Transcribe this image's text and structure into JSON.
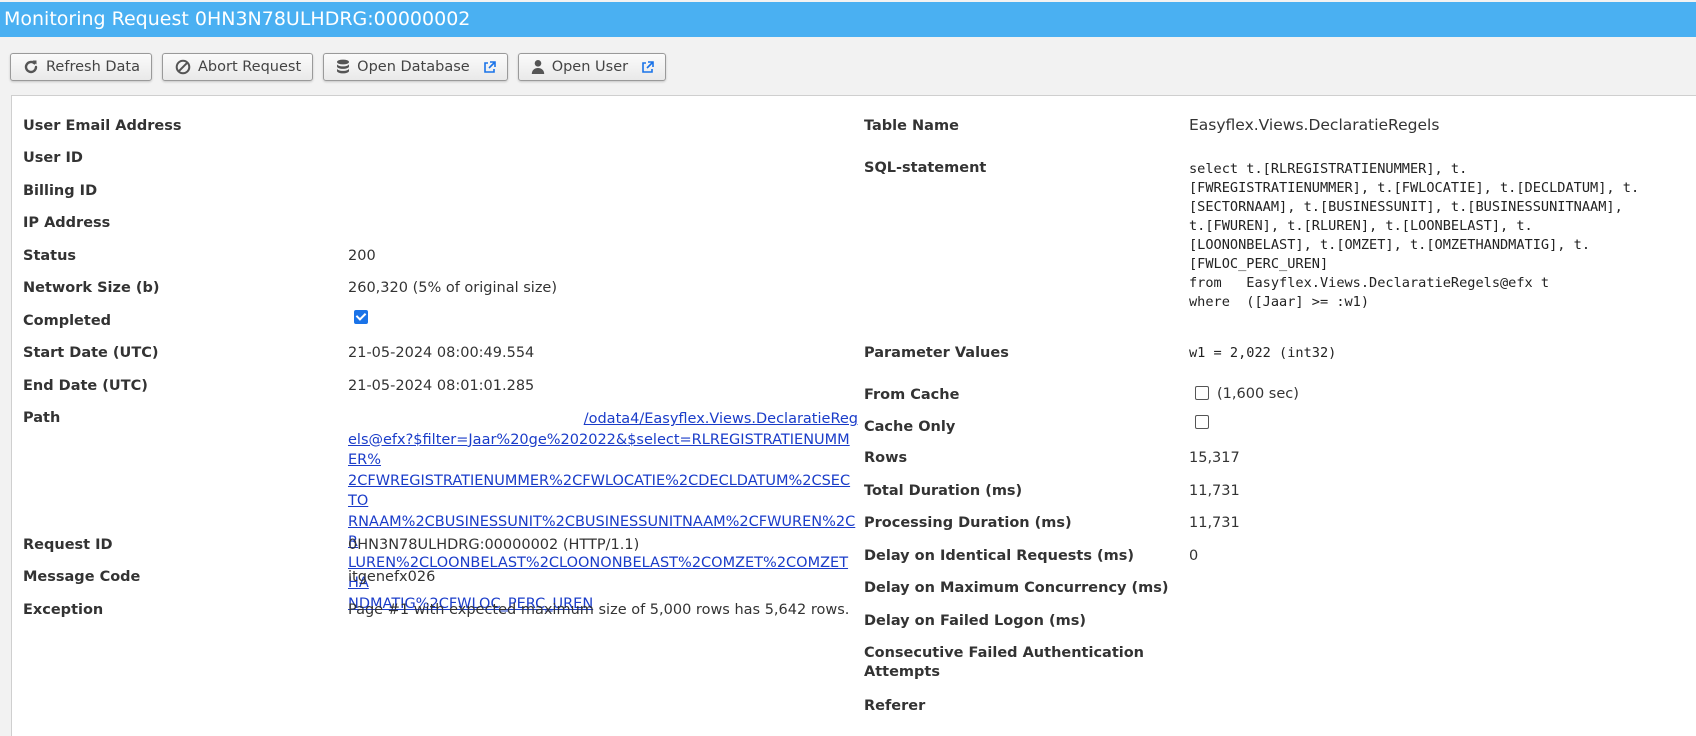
{
  "window": {
    "title": "Monitoring Request 0HN3N78ULHDRG:00000002"
  },
  "toolbar": {
    "refresh_label": "Refresh Data",
    "abort_label": "Abort Request",
    "open_database_label": "Open Database",
    "open_user_label": "Open User"
  },
  "left": {
    "user_email": {
      "label": "User Email Address",
      "value": ""
    },
    "user_id": {
      "label": "User ID",
      "value": ""
    },
    "billing_id": {
      "label": "Billing ID",
      "value": ""
    },
    "ip_address": {
      "label": "IP Address",
      "value": ""
    },
    "status": {
      "label": "Status",
      "value": "200"
    },
    "network_size": {
      "label": "Network Size (b)",
      "value": "260,320 (5% of original size)"
    },
    "completed": {
      "label": "Completed",
      "checked": true
    },
    "start_date": {
      "label": "Start Date (UTC)",
      "value": "21-05-2024 08:00:49.554"
    },
    "end_date": {
      "label": "End Date (UTC)",
      "value": "21-05-2024 08:01:01.285"
    },
    "path": {
      "label": "Path",
      "line1": "/odata4/Easyflex.Views.DeclaratieReg",
      "line2": "els@efx?$filter=Jaar%20ge%202022&$select=RLREGISTRATIENUMMER%",
      "line3": "2CFWREGISTRATIENUMMER%2CFWLOCATIE%2CDECLDATUM%2CSECTO",
      "line4": "RNAAM%2CBUSINESSUNIT%2CBUSINESSUNITNAAM%2CFWUREN%2CR",
      "line5": "LUREN%2CLOONBELAST%2CLOONONBELAST%2COMZET%2COMZETHA",
      "line6": "NDMATIG%2CFWLOC_PERC_UREN"
    },
    "request_id": {
      "label": "Request ID",
      "value": "0HN3N78ULHDRG:00000002 (HTTP/1.1)"
    },
    "message_code": {
      "label": "Message Code",
      "value": "itgenefx026"
    },
    "exception": {
      "label": "Exception",
      "value": "Page #1 with expected maximum size of 5,000 rows has 5,642 rows."
    }
  },
  "right": {
    "table_name": {
      "label": "Table Name",
      "value": "Easyflex.Views.DeclaratieRegels"
    },
    "sql": {
      "label": "SQL-statement",
      "l1": "select t.[RLREGISTRATIENUMMER], t.",
      "l2": "[FWREGISTRATIENUMMER], t.[FWLOCATIE], t.[DECLDATUM], t.",
      "l3": "[SECTORNAAM], t.[BUSINESSUNIT], t.[BUSINESSUNITNAAM],",
      "l4": "t.[FWUREN], t.[RLUREN], t.[LOONBELAST], t.",
      "l5": "[LOONONBELAST], t.[OMZET], t.[OMZETHANDMATIG], t.",
      "l6": "[FWLOC_PERC_UREN]",
      "l7": "from   Easyflex.Views.DeclaratieRegels@efx t",
      "l8": "where  ([Jaar] >= :w1)"
    },
    "parameter_values": {
      "label": "Parameter Values",
      "value": "w1 = 2,022 (int32)"
    },
    "from_cache": {
      "label": "From Cache",
      "checked": false,
      "value": "(1,600 sec)"
    },
    "cache_only": {
      "label": "Cache Only",
      "checked": false
    },
    "rows": {
      "label": "Rows",
      "value": "15,317"
    },
    "total_duration": {
      "label": "Total Duration (ms)",
      "value": "11,731"
    },
    "processing_duration": {
      "label": "Processing Duration (ms)",
      "value": "11,731"
    },
    "delay_identical": {
      "label": "Delay on Identical Requests (ms)",
      "value": "0"
    },
    "delay_concurrency": {
      "label": "Delay on Maximum Concurrency (ms)",
      "value": ""
    },
    "delay_failed_logon": {
      "label": "Delay on Failed Logon (ms)",
      "value": ""
    },
    "consecutive_failed": {
      "label_l1": "Consecutive Failed Authentication",
      "label_l2": "Attempts",
      "value": ""
    },
    "referer": {
      "label": "Referer",
      "value": ""
    }
  },
  "colors": {
    "titlebar": "#4ab0f2",
    "link": "#1a3cc9",
    "checkbox_accent": "#1a73e8"
  }
}
